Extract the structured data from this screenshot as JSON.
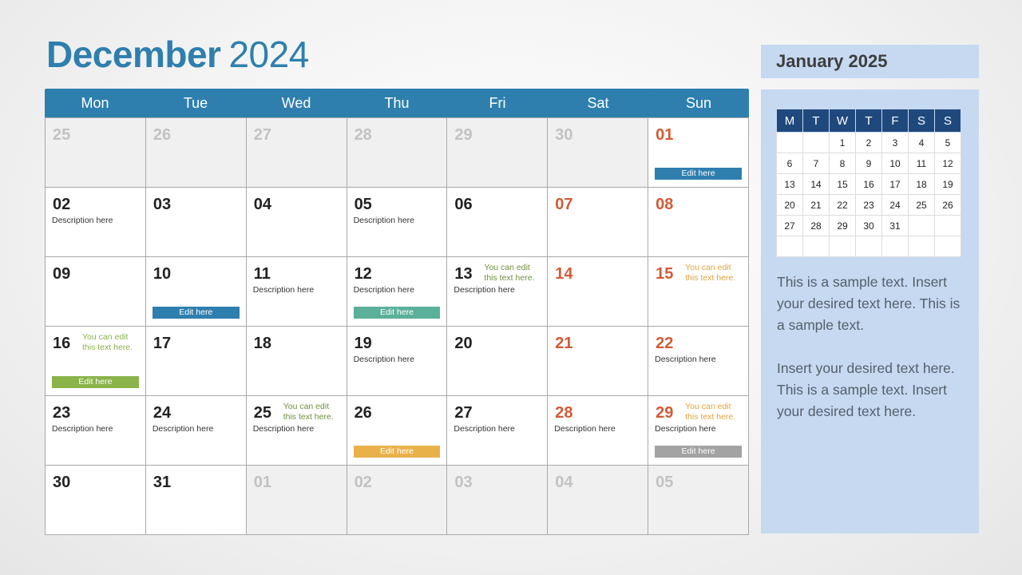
{
  "header": {
    "month": "December",
    "year": "2024"
  },
  "weekdays": [
    "Mon",
    "Tue",
    "Wed",
    "Thu",
    "Fri",
    "Sat",
    "Sun"
  ],
  "colors": {
    "primary": "#2e7fae",
    "weekend": "#d35a35",
    "tag_blue": "#2e7fae",
    "tag_teal": "#5bb09a",
    "tag_green": "#8ab34a",
    "tag_yellow": "#e9b14a",
    "tag_gray": "#a3a3a3",
    "note_green": "#6f8f3c",
    "note_orange": "#e2a23c"
  },
  "weeks": [
    [
      {
        "day": "25",
        "other": true
      },
      {
        "day": "26",
        "other": true
      },
      {
        "day": "27",
        "other": true
      },
      {
        "day": "28",
        "other": true
      },
      {
        "day": "29",
        "other": true
      },
      {
        "day": "30",
        "other": true
      },
      {
        "day": "01",
        "weekend": true,
        "tag": "Edit here",
        "tag_color": "#2e7fae"
      }
    ],
    [
      {
        "day": "02",
        "desc": "Description here"
      },
      {
        "day": "03"
      },
      {
        "day": "04"
      },
      {
        "day": "05",
        "desc": "Description here"
      },
      {
        "day": "06"
      },
      {
        "day": "07",
        "weekend": true
      },
      {
        "day": "08",
        "weekend": true
      }
    ],
    [
      {
        "day": "09"
      },
      {
        "day": "10",
        "tag": "Edit here",
        "tag_color": "#2e7fae"
      },
      {
        "day": "11",
        "desc": "Description here"
      },
      {
        "day": "12",
        "desc": "Description here",
        "tag": "Edit here",
        "tag_color": "#5bb09a"
      },
      {
        "day": "13",
        "desc": "Description here",
        "note": [
          "You can edit",
          "this text here."
        ],
        "note_color": "#6f8f3c"
      },
      {
        "day": "14",
        "weekend": true
      },
      {
        "day": "15",
        "weekend": true,
        "note": [
          "You can edit",
          "this text here."
        ],
        "note_color": "#e2a23c"
      }
    ],
    [
      {
        "day": "16",
        "note": [
          "You can edit",
          "this text here."
        ],
        "note_color": "#8ab34a",
        "tag": "Edit here",
        "tag_color": "#8ab34a"
      },
      {
        "day": "17"
      },
      {
        "day": "18"
      },
      {
        "day": "19",
        "desc": "Description here"
      },
      {
        "day": "20"
      },
      {
        "day": "21",
        "weekend": true
      },
      {
        "day": "22",
        "weekend": true,
        "desc": "Description here"
      }
    ],
    [
      {
        "day": "23",
        "desc": "Description here"
      },
      {
        "day": "24",
        "desc": "Description here"
      },
      {
        "day": "25",
        "desc": "Description here",
        "note": [
          "You can edit",
          "this text here."
        ],
        "note_color": "#6f8f3c"
      },
      {
        "day": "26",
        "tag": "Edit here",
        "tag_color": "#e9b14a"
      },
      {
        "day": "27",
        "desc": "Description here"
      },
      {
        "day": "28",
        "weekend": true,
        "desc": "Description here"
      },
      {
        "day": "29",
        "weekend": true,
        "desc": "Description here",
        "note": [
          "You can edit",
          "this text here."
        ],
        "note_color": "#e2a23c",
        "tag": "Edit here",
        "tag_color": "#a3a3a3"
      }
    ],
    [
      {
        "day": "30"
      },
      {
        "day": "31"
      },
      {
        "day": "01",
        "other": true
      },
      {
        "day": "02",
        "other": true
      },
      {
        "day": "03",
        "other": true
      },
      {
        "day": "04",
        "other": true
      },
      {
        "day": "05",
        "other": true
      }
    ]
  ],
  "sidebar": {
    "title": "January 2025",
    "mini_headers": [
      "M",
      "T",
      "W",
      "T",
      "F",
      "S",
      "S"
    ],
    "mini_weeks": [
      [
        "",
        "",
        "1",
        "2",
        "3",
        "4",
        "5"
      ],
      [
        "6",
        "7",
        "8",
        "9",
        "10",
        "11",
        "12"
      ],
      [
        "13",
        "14",
        "15",
        "16",
        "17",
        "18",
        "19"
      ],
      [
        "20",
        "21",
        "22",
        "23",
        "24",
        "25",
        "26"
      ],
      [
        "27",
        "28",
        "29",
        "30",
        "31",
        "",
        ""
      ],
      [
        "",
        "",
        "",
        "",
        "",
        "",
        ""
      ]
    ],
    "paragraphs": [
      "This is a sample text. Insert your desired text here. This is a sample text.",
      "Insert your desired text here. This is a sample text. Insert your desired text here."
    ]
  }
}
